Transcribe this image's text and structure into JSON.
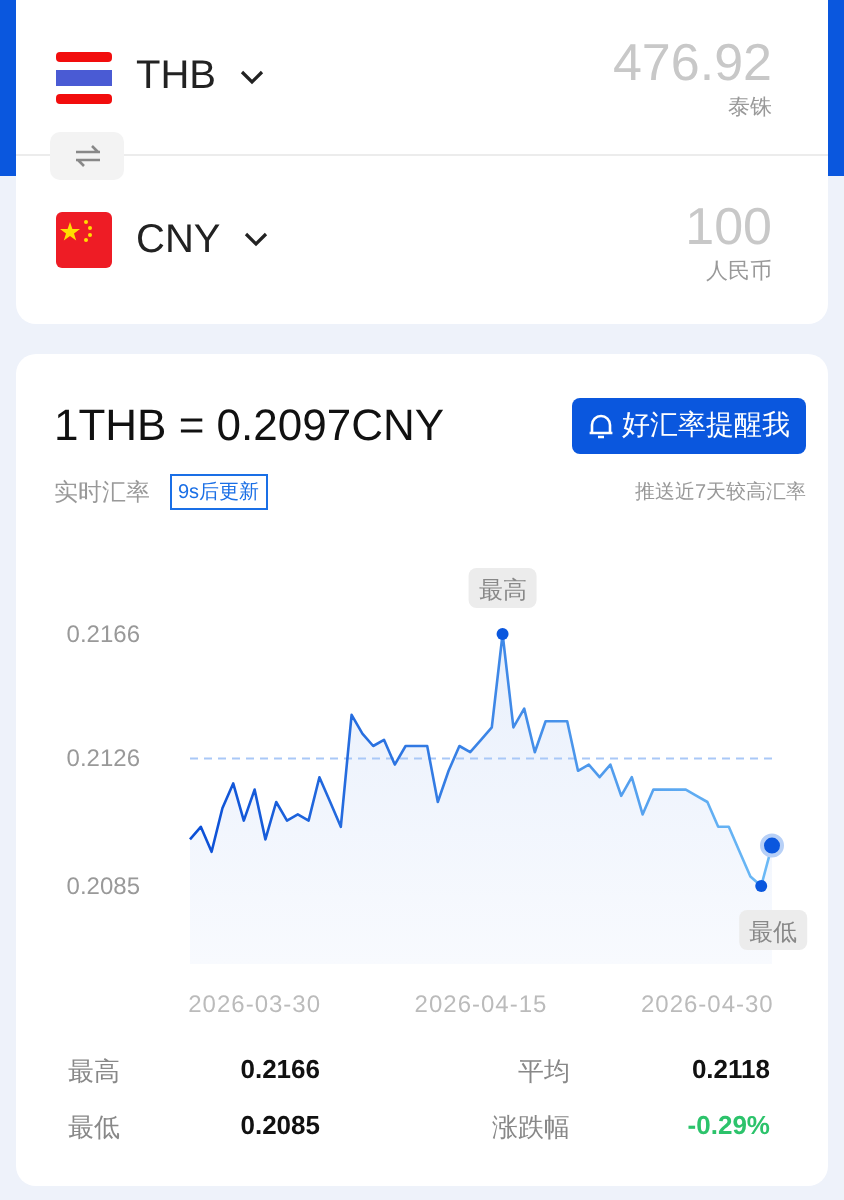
{
  "converter": {
    "rows": [
      {
        "code": "THB",
        "kind": "th",
        "amount": "476.92",
        "unit": "泰铢"
      },
      {
        "code": "CNY",
        "kind": "cn",
        "amount": "100",
        "unit": "人民币"
      }
    ]
  },
  "rate": {
    "title": "1THB = 0.2097CNY",
    "alert_button": "好汇率提醒我",
    "label": "实时汇率",
    "refresh_badge": "9s后更新",
    "hint": "推送近7天较高汇率",
    "high_label": "最高",
    "low_label": "最低",
    "chart_data": {
      "type": "area",
      "categories": [
        null,
        null,
        null,
        null,
        null,
        null,
        "2026-03-30",
        null,
        null,
        null,
        null,
        null,
        null,
        null,
        null,
        null,
        null,
        null,
        null,
        null,
        null,
        null,
        null,
        null,
        null,
        null,
        null,
        "2026-04-15",
        null,
        null,
        null,
        null,
        null,
        null,
        null,
        null,
        null,
        null,
        null,
        null,
        null,
        null,
        null,
        null,
        null,
        null,
        null,
        null,
        "2026-04-30",
        null,
        null,
        null,
        null,
        null,
        null
      ],
      "series": [
        {
          "color": "#0b4fd6",
          "values": [
            0.21,
            0.2104,
            0.2096,
            0.211,
            0.2118,
            0.2106,
            0.2116,
            0.21,
            0.2112,
            0.2106,
            0.2108,
            0.2106,
            0.212,
            0.2112,
            0.2104,
            0.214,
            0.2134,
            0.213,
            0.2132,
            0.2124,
            0.213,
            0.213,
            0.213,
            0.2112,
            0.2122,
            0.213,
            0.2128,
            0.2132,
            0.2136,
            0.2166,
            0.2136,
            0.2142,
            0.2128,
            0.2138,
            0.2138,
            0.2138,
            0.2122,
            0.2124,
            0.212,
            0.2124,
            0.2114,
            0.212,
            0.2108,
            0.2116,
            0.2116,
            0.2116,
            0.2116,
            0.2114,
            0.2112,
            0.2104,
            0.2104,
            0.2096,
            0.2088,
            0.2085,
            0.2098
          ]
        }
      ],
      "ylim": [
        0.2085,
        0.2166
      ],
      "yticks": [
        0.2166,
        0.2126,
        0.2085
      ],
      "ref_lines": [
        {
          "axis": "y",
          "value": 0.2126,
          "color": "#a9c8f7"
        }
      ]
    }
  },
  "stats": [
    {
      "label": "最高",
      "value": "0.2166",
      "color": "#111111"
    },
    {
      "label": "平均",
      "value": "0.2118",
      "color": "#111111"
    },
    {
      "label": "最低",
      "value": "0.2085",
      "color": "#111111"
    },
    {
      "label": "涨跌幅",
      "value": "-0.29%",
      "color": "#2cc36b"
    }
  ]
}
